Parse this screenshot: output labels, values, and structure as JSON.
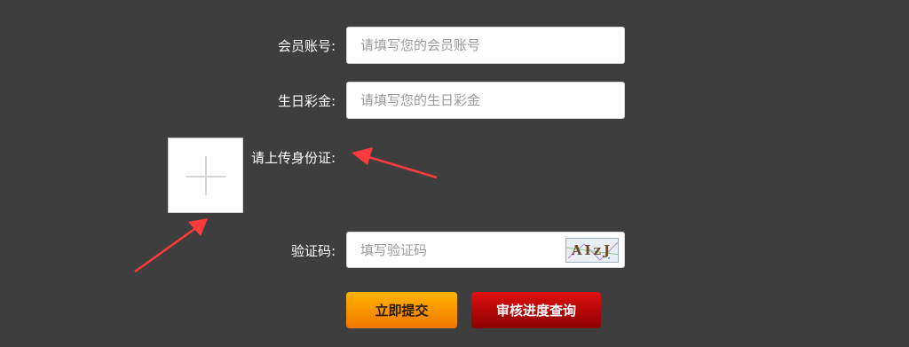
{
  "form": {
    "account": {
      "label": "会员账号:",
      "placeholder": "请填写您的会员账号"
    },
    "bonus": {
      "label": "生日彩金:",
      "placeholder": "请填写您的生日彩金"
    },
    "id_upload": {
      "label": "请上传身份证:",
      "icon": "plus-icon"
    },
    "captcha": {
      "label": "验证码:",
      "placeholder": "填写验证码",
      "image_text": "AIzJ"
    }
  },
  "buttons": {
    "submit": "立即提交",
    "query": "审核进度查询"
  },
  "colors": {
    "background": "#3e3e3e",
    "submit_button": "#f9a000",
    "query_button": "#c80000",
    "annotation_arrow": "#ff3b3b"
  }
}
